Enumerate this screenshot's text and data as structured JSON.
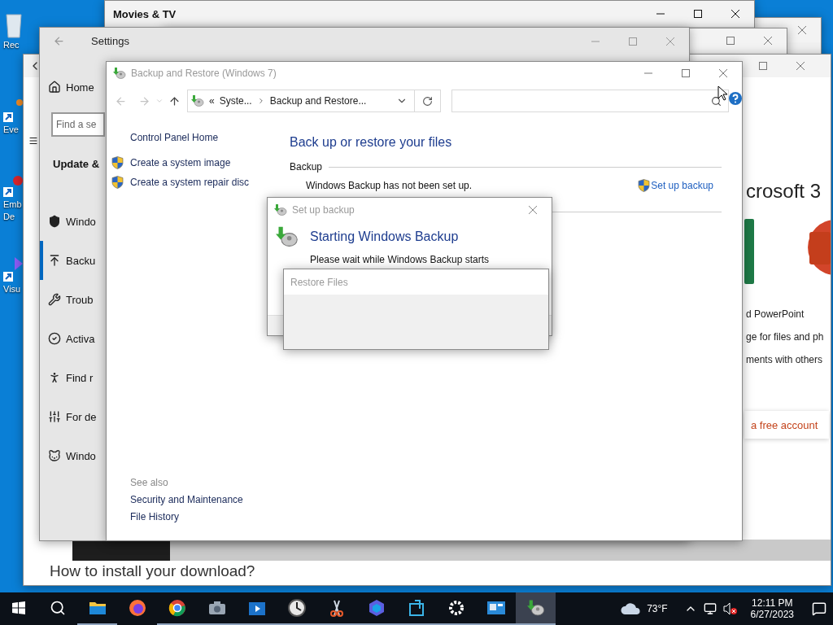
{
  "desktop_icons": [
    {
      "lines": [
        "Rec"
      ]
    },
    {
      "lines": [
        "Eve"
      ]
    },
    {
      "lines": [
        "Emb",
        "De"
      ]
    },
    {
      "lines": [
        "Visu"
      ]
    }
  ],
  "movies_window": {
    "title": "Movies & TV"
  },
  "browser_window": {
    "heading": "crosoft 3",
    "lines": [
      "d PowerPoint",
      "ge for files and ph",
      "ments with others"
    ],
    "button": "a free account",
    "footer_heading": "How to install your download?"
  },
  "settings_window": {
    "title": "Settings",
    "home": "Home",
    "search_placeholder": "Find a se",
    "section": "Update &",
    "nav": [
      {
        "label": "Windo",
        "selected": false
      },
      {
        "label": "Backu",
        "selected": true
      },
      {
        "label": "Troub",
        "selected": false
      },
      {
        "label": "Activa",
        "selected": false
      },
      {
        "label": "Find r",
        "selected": false
      },
      {
        "label": "For de",
        "selected": false
      },
      {
        "label": "Windo",
        "selected": false
      }
    ]
  },
  "backup_window": {
    "title": "Backup and Restore (Windows 7)",
    "breadcrumb_prefix": "«",
    "breadcrumb": [
      "Syste...",
      "Backup and Restore..."
    ],
    "sidebar": {
      "home": "Control Panel Home",
      "tasks": [
        "Create a system image",
        "Create a system repair disc"
      ],
      "see_also_title": "See also",
      "see_also": [
        "Security and Maintenance",
        "File History"
      ]
    },
    "heading": "Back up or restore your files",
    "section": "Backup",
    "status": "Windows Backup has not been set up.",
    "action": "Set up backup"
  },
  "setup_dialog": {
    "title": "Set up backup",
    "heading": "Starting Windows Backup",
    "message": "Please wait while Windows Backup starts"
  },
  "restore_window": {
    "title": "Restore Files"
  },
  "taskbar": {
    "apps": [
      {
        "running": true,
        "active": false
      },
      {
        "running": false,
        "active": false
      },
      {
        "running": true,
        "active": false
      },
      {
        "running": true,
        "active": false
      },
      {
        "running": true,
        "active": false
      },
      {
        "running": true,
        "active": false
      },
      {
        "running": true,
        "active": false
      },
      {
        "running": true,
        "active": false
      },
      {
        "running": true,
        "active": false
      },
      {
        "running": true,
        "active": false
      },
      {
        "running": true,
        "active": false
      },
      {
        "running": true,
        "active": true
      }
    ],
    "weather": "73°F",
    "time": "12:11 PM",
    "date": "6/27/2023"
  }
}
